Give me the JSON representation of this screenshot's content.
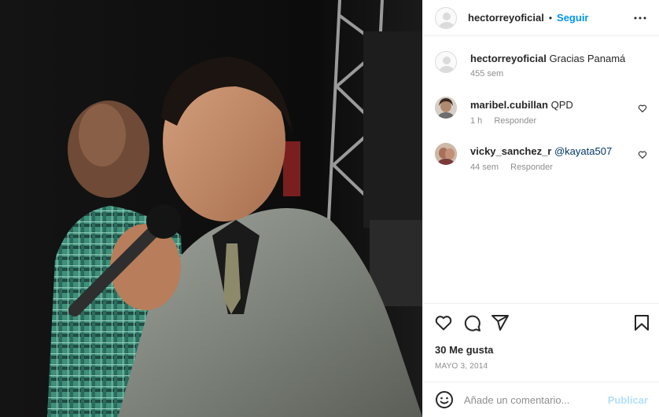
{
  "post": {
    "image_alt": "Hombre cantando con micrófono junto a otro hombre",
    "colors": {
      "accent": "#0095f6",
      "mention": "#00376b",
      "muted": "#8e8e8e"
    }
  },
  "header": {
    "username": "hectorreyoficial",
    "separator": "•",
    "follow_label": "Seguir",
    "more_icon": "more-horizontal-icon"
  },
  "caption": {
    "username": "hectorreyoficial",
    "text": "Gracias Panamá",
    "time": "455 sem"
  },
  "comments": [
    {
      "username": "maribel.cubillan",
      "text": "QPD",
      "mention": "",
      "time": "1 h",
      "reply_label": "Responder"
    },
    {
      "username": "vicky_sanchez_r",
      "text": "",
      "mention": "@kayata507",
      "time": "44 sem",
      "reply_label": "Responder"
    }
  ],
  "actions": {
    "like_icon": "heart-icon",
    "comment_icon": "comment-icon",
    "share_icon": "share-icon",
    "save_icon": "bookmark-icon"
  },
  "likes": "30 Me gusta",
  "date": "MAYO 3, 2014",
  "comment_bar": {
    "emoji_icon": "emoji-icon",
    "placeholder": "Añade un comentario...",
    "publish_label": "Publicar"
  }
}
